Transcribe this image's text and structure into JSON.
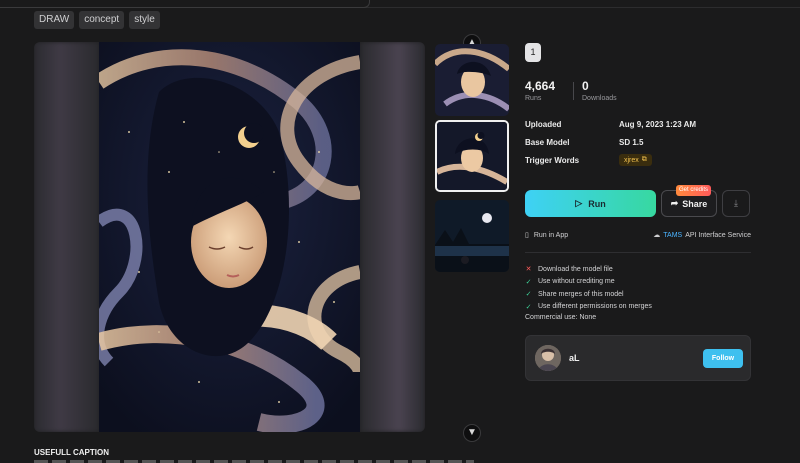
{
  "tags": [
    "DRAW",
    "concept",
    "style"
  ],
  "gallery": {
    "prev_icon": "chevron-up-icon",
    "next_icon": "chevron-down-icon"
  },
  "version_badge": "1",
  "stats": {
    "runs_value": "4,664",
    "runs_label": "Runs",
    "downloads_value": "0",
    "downloads_label": "Downloads"
  },
  "meta": {
    "uploaded_key": "Uploaded",
    "uploaded_value": "Aug 9, 2023 1:23 AM",
    "base_model_key": "Base Model",
    "base_model_value": "SD 1.5",
    "trigger_key": "Trigger Words",
    "trigger_value": "xjrex"
  },
  "actions": {
    "run_label": "Run",
    "share_label": "Share",
    "credits_label": "Get credits",
    "download_icon": "download-icon"
  },
  "links": {
    "run_in_app": "Run in App",
    "tams_brand": "TAMS",
    "tams_rest": "API Interface Service"
  },
  "permissions": [
    {
      "allowed": false,
      "text": "Download the model file"
    },
    {
      "allowed": true,
      "text": "Use without crediting me"
    },
    {
      "allowed": true,
      "text": "Share merges of this model"
    },
    {
      "allowed": true,
      "text": "Use different permissions on merges"
    }
  ],
  "commercial_use": "Commercial use: None",
  "author": {
    "name": "aL",
    "follow_label": "Follow"
  },
  "caption_title": "USEFULL CAPTION",
  "colors": {
    "run_gradient_start": "#3ed1f5",
    "run_gradient_end": "#37d8a0",
    "follow": "#3ec0ef",
    "allowed": "#3fd49a",
    "denied": "#ff5a5a",
    "trigger_text": "#f2c14e"
  }
}
